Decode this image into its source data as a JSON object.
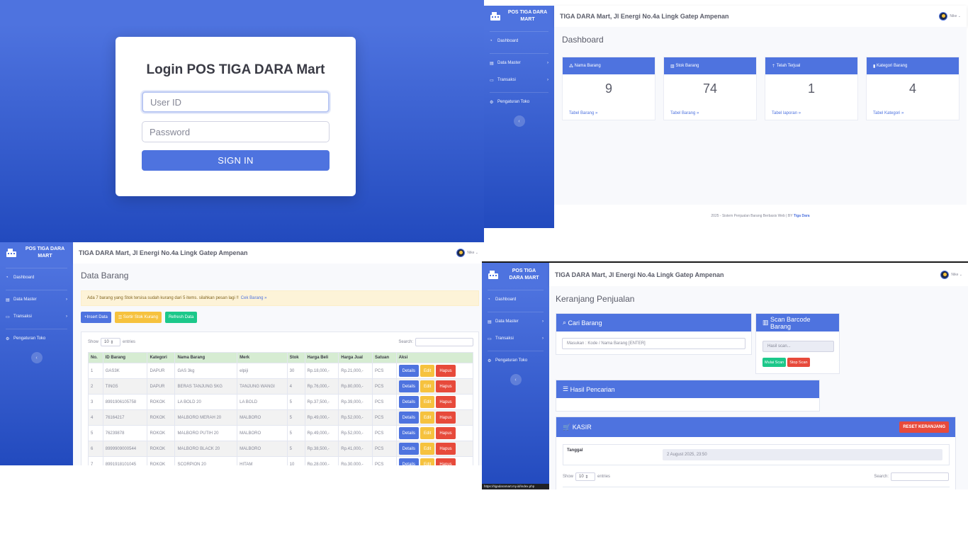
{
  "login": {
    "title": "Login POS TIGA DARA Mart",
    "user_placeholder": "User ID",
    "password_placeholder": "Password",
    "submit_label": "SIGN IN"
  },
  "app": {
    "brand": "POS TIGA DARA MART",
    "store_title": "TIGA DARA Mart, Jl Energi No.4a Lingk Gatep Ampenan",
    "user_name": "Nike",
    "sidebar": {
      "dashboard": "Dashboard",
      "data_master": "Data Master",
      "transaksi": "Transaksi",
      "pengaturan": "Pengaturan Toko"
    }
  },
  "dashboard": {
    "title": "Dashboard",
    "stats": [
      {
        "label": "Nama Barang",
        "value": "9",
        "link": "Tabel Barang",
        "icon": "cubes-icon"
      },
      {
        "label": "Stok Barang",
        "value": "74",
        "link": "Tabel Barang",
        "icon": "chart-icon"
      },
      {
        "label": "Telah Terjual",
        "value": "1",
        "link": "Tabel laporan",
        "icon": "upload-icon"
      },
      {
        "label": "Kategori Barang",
        "value": "4",
        "link": "Tabel Kategori",
        "icon": "bookmark-icon"
      }
    ],
    "footer_text": "2025 - Sistem Penjualan Barang Berbasis Web | BY",
    "footer_brand": "Tiga Dara"
  },
  "data_barang": {
    "title": "Data Barang",
    "alert_text": "Ada 7 barang yang Stok tersisa sudah kurang dari 5 items. silahkan pesan lagi !!",
    "alert_link": "Cek Barang",
    "btn_insert": "Insert Data",
    "btn_sortir": "Sortir Stok Kurang",
    "btn_refresh": "Refresh Data",
    "show_label": "Show",
    "entries_value": "10",
    "entries_label": "entries",
    "search_label": "Search:",
    "columns": [
      "No.",
      "ID Barang",
      "Kategori",
      "Nama Barang",
      "Merk",
      "Stok",
      "Harga Beli",
      "Harga Jual",
      "Satuan",
      "Aksi"
    ],
    "rows": [
      [
        "1",
        "GAS3K",
        "DAPUR",
        "GAS 3kg",
        "elpiji",
        "30",
        "Rp.18,000,-",
        "Rp.21,000,-",
        "PCS"
      ],
      [
        "2",
        "TING5",
        "DAPUR",
        "BERAS TANJUNG 5KG",
        "TANJUNG WANGI",
        "4",
        "Rp.76,000,-",
        "Rp.80,000,-",
        "PCS"
      ],
      [
        "3",
        "8991906105758",
        "ROKOK",
        "LA BOLD 20",
        "LA BOLD",
        "5",
        "Rp.37,500,-",
        "Rp.39,000,-",
        "PCS"
      ],
      [
        "4",
        "76164217",
        "ROKOK",
        "MALBORO MERAH 20",
        "MALBORO",
        "5",
        "Rp.49,000,-",
        "Rp.52,000,-",
        "PCS"
      ],
      [
        "5",
        "76239878",
        "ROKOK",
        "MALBORO PUTIH 20",
        "MALBORO",
        "5",
        "Rp.49,000,-",
        "Rp.52,000,-",
        "PCS"
      ],
      [
        "6",
        "8999909000544",
        "ROKOK",
        "MALBORO BLACK 20",
        "MALBORO",
        "5",
        "Rp.38,500,-",
        "Rp.41,000,-",
        "PCS"
      ],
      [
        "7",
        "8991918101045",
        "ROKOK",
        "SCORPION 20",
        "HITAM",
        "10",
        "Rp.28,000,-",
        "Rp.30,000,-",
        "PCS"
      ]
    ],
    "action_details": "Details",
    "action_edit": "Edit",
    "action_hapus": "Hapus"
  },
  "keranjang": {
    "title": "Keranjang Penjualan",
    "cari_title": "Cari Barang",
    "cari_placeholder": "Masukan : Kode / Nama Barang [ENTER]",
    "scan_title": "Scan Barcode Barang",
    "scan_placeholder": "Hasil scan...",
    "btn_mulai": "Mulai Scan",
    "btn_stop": "Stop Scan",
    "hasil_title": "Hasil Pencarian",
    "kasir_title": "KASIR",
    "btn_reset": "RESET KERANJANG",
    "tanggal_label": "Tanggal",
    "tanggal_value": "2 August 2025, 23:50",
    "show_label": "Show",
    "entries_value": "10",
    "entries_label": "entries",
    "search_label": "Search:",
    "status_url": "https://tigadaramart.my.id/index.php"
  },
  "colors": {
    "primary": "#4e73df",
    "warning": "#f6c23e",
    "success": "#1cc88a",
    "danger": "#e74a3b"
  }
}
